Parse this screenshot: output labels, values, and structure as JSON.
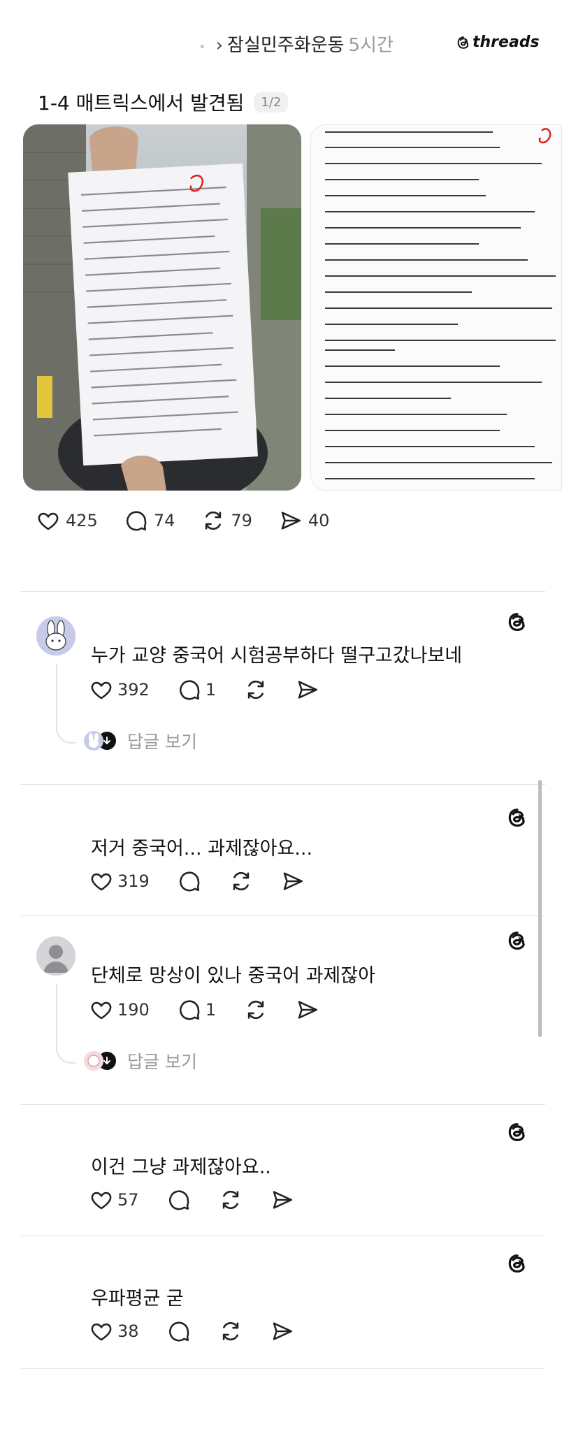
{
  "header": {
    "group_name": "잠실민주화운동",
    "time_ago": "5시간",
    "brand": "threads"
  },
  "post": {
    "found_label": "1-4 매트릭스에서 발견됨",
    "pager": "1/2",
    "photo1_label": "handwritten-quiz-paper-photo",
    "photo2_label": "chinese-quiz-scan",
    "stats": {
      "likes": "425",
      "comments": "74",
      "reposts": "79",
      "shares": "40"
    }
  },
  "comments": [
    {
      "text": "누가 교양 중국어 시험공부하다 떨구고갔나보네",
      "likes": "392",
      "replies": "1",
      "view_replies": "답글 보기"
    },
    {
      "text": "저거 중국어... 과제잖아요...",
      "likes": "319",
      "replies": ""
    },
    {
      "text": "단체로 망상이 있나 중국어 과제잖아",
      "likes": "190",
      "replies": "1",
      "view_replies": "답글 보기"
    },
    {
      "text": "이건 그냥 과제잖아요..",
      "likes": "57",
      "replies": ""
    },
    {
      "text": "우파평균 굳",
      "likes": "38",
      "replies": ""
    }
  ],
  "icons": {
    "heart": "heart-icon",
    "comment": "comment-icon",
    "repost": "repost-icon",
    "share": "send-icon",
    "threads": "threads-logo-icon"
  },
  "colors": {
    "text": "#111111",
    "muted": "#999999",
    "divider": "#e4e4e4"
  }
}
